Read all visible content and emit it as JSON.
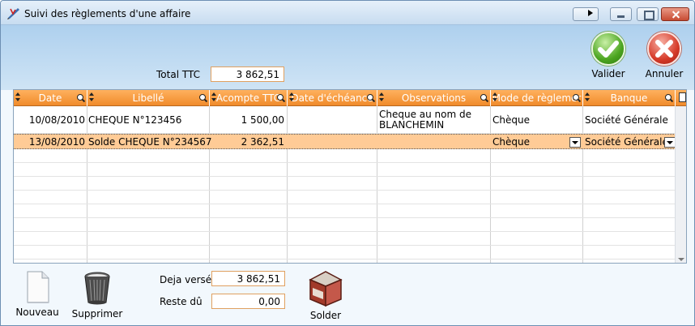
{
  "window": {
    "title": "Suivi des règlements d'une affaire"
  },
  "header": {
    "total_label": "Total TTC",
    "total_value": "3 862,51",
    "valider_label": "Valider",
    "annuler_label": "Annuler"
  },
  "grid": {
    "columns": [
      "Date",
      "Libellé",
      "Acompte TTC",
      "Date d'échéance",
      "Observations",
      "Mode de règlemer",
      "Banque"
    ],
    "rows": [
      {
        "date": "10/08/2010",
        "libelle": "CHEQUE N°123456",
        "acompte": "1 500,00",
        "echeance": "",
        "obs1": "Cheque au nom de",
        "obs2": "BLANCHEMIN",
        "mode": "Chèque",
        "banque": "Société Générale"
      },
      {
        "date": "13/08/2010",
        "libelle": "Solde CHEQUE N°234567",
        "acompte": "2 362,51",
        "echeance": "",
        "obs1": "",
        "obs2": "",
        "mode": "Chèque",
        "banque": "Société Générale"
      }
    ]
  },
  "footer": {
    "nouveau_label": "Nouveau",
    "supprimer_label": "Supprimer",
    "deja_verse_label": "Deja versé",
    "deja_verse_value": "3 862,51",
    "reste_du_label": "Reste dû",
    "reste_du_value": "0,00",
    "solder_label": "Solder"
  },
  "colors": {
    "header_orange": "#f08b2b",
    "selected_row": "#ffcb96",
    "field_border": "#e0a060"
  }
}
